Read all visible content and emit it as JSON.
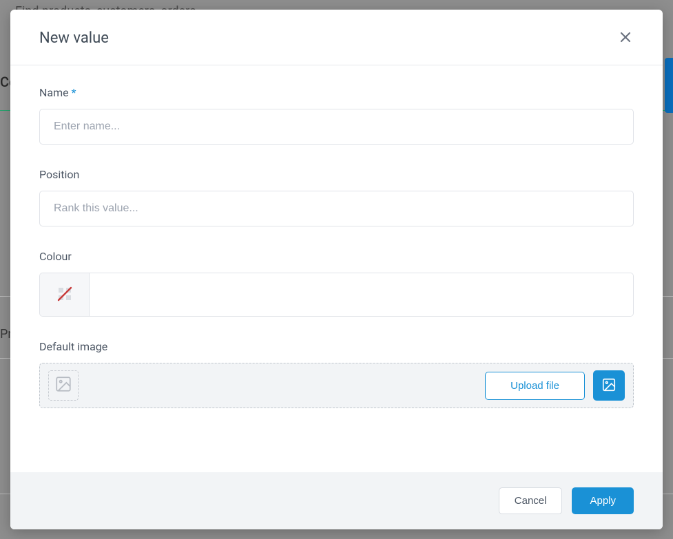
{
  "background": {
    "search_placeholder": "Find products, customers, orders",
    "left_text_1": "Co",
    "left_text_2": "Pr"
  },
  "modal": {
    "title": "New value",
    "fields": {
      "name": {
        "label": "Name",
        "required_marker": "*",
        "placeholder": "Enter name...",
        "value": ""
      },
      "position": {
        "label": "Position",
        "placeholder": "Rank this value...",
        "value": ""
      },
      "colour": {
        "label": "Colour",
        "swatch_icon": "no-colour-icon",
        "value": ""
      },
      "default_image": {
        "label": "Default image",
        "upload_label": "Upload file",
        "media_icon": "image-icon"
      }
    },
    "footer": {
      "cancel_label": "Cancel",
      "apply_label": "Apply"
    }
  }
}
